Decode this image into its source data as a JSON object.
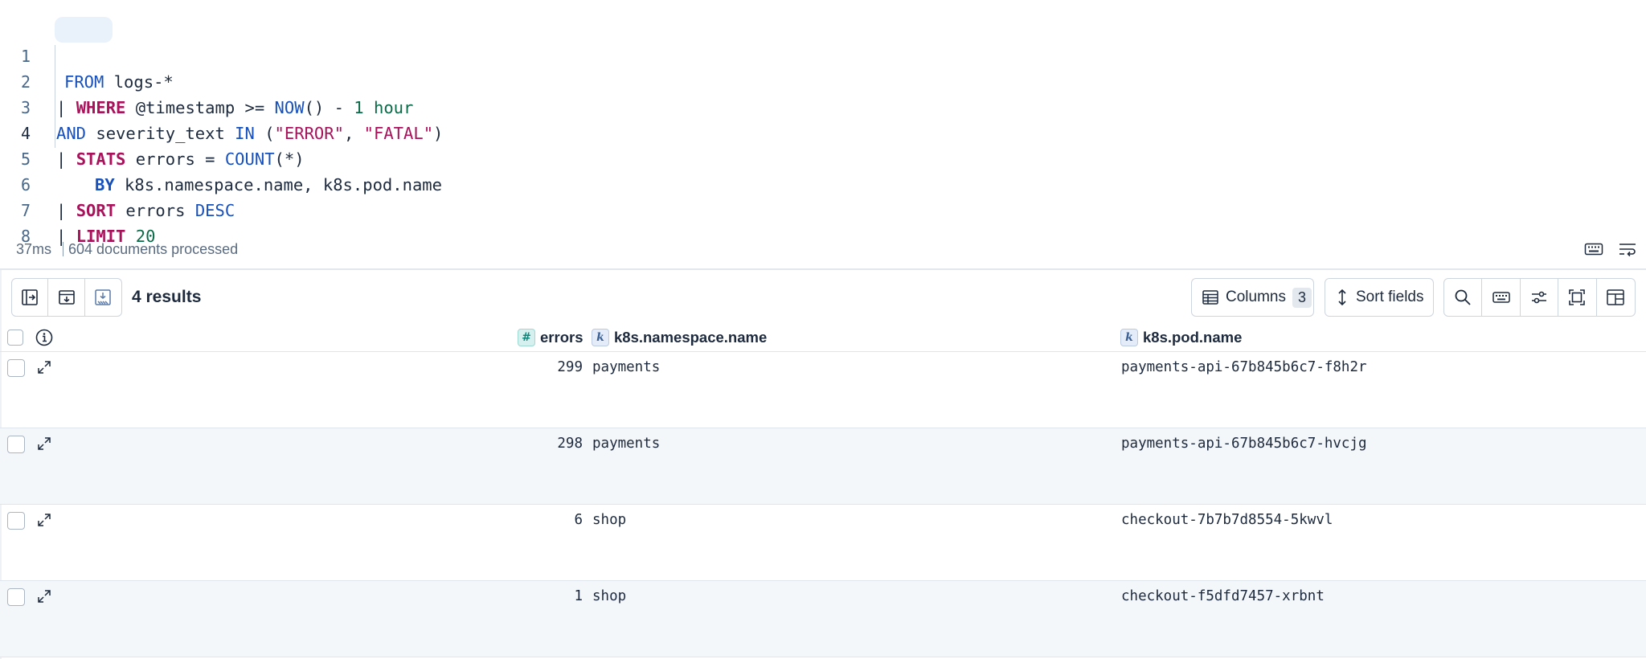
{
  "editor": {
    "line_numbers": [
      "1",
      "2",
      "3",
      "4",
      "5",
      "6",
      "7",
      "8"
    ],
    "line1": {
      "kw": "FROM",
      "rest": " logs-*"
    },
    "line2": {
      "pipe": "| ",
      "kw": "WHERE",
      "a": " @timestamp >= ",
      "fn": "NOW",
      "b": "() - ",
      "num": "1",
      "c": " ",
      "unit": "hour"
    },
    "line3": {
      "kw": "AND",
      "a": " severity_text ",
      "in": "IN",
      "b": " (",
      "s1": "\"ERROR\"",
      "comma": ", ",
      "s2": "\"FATAL\"",
      "c": ")"
    },
    "line4": {
      "pipe": "| ",
      "kw": "STATS",
      "a": " errors = ",
      "fn": "COUNT",
      "b": "(*)"
    },
    "line5": {
      "kw": "BY",
      "a": " k8s.namespace.name, k8s.pod.name"
    },
    "line6": {
      "pipe": "| ",
      "kw": "SORT",
      "a": " errors ",
      "dir": "DESC"
    },
    "line7": {
      "pipe": "| ",
      "kw": "LIMIT",
      "a": " ",
      "num": "20"
    }
  },
  "status": {
    "time": "37ms",
    "docs": "604 documents processed"
  },
  "toolbar": {
    "results": "4 results",
    "columns_label": "Columns",
    "columns_count": "3",
    "sort_label": "Sort fields"
  },
  "grid": {
    "columns": [
      {
        "name": "errors",
        "type": "#"
      },
      {
        "name": "k8s.namespace.name",
        "type": "k"
      },
      {
        "name": "k8s.pod.name",
        "type": "k"
      }
    ],
    "rows": [
      {
        "errors": "299",
        "namespace": "payments",
        "pod": "payments-api-67b845b6c7-f8h2r"
      },
      {
        "errors": "298",
        "namespace": "payments",
        "pod": "payments-api-67b845b6c7-hvcjg"
      },
      {
        "errors": "6",
        "namespace": "shop",
        "pod": "checkout-7b7b7d8554-5kwvl"
      },
      {
        "errors": "1",
        "namespace": "shop",
        "pod": "checkout-f5dfd7457-xrbnt"
      }
    ]
  },
  "colors": {
    "keyword_pink": "#a8125a",
    "keyword_blue": "#1750ba",
    "number_green": "#0a6b48",
    "row_alt": "#f4f7fa"
  }
}
